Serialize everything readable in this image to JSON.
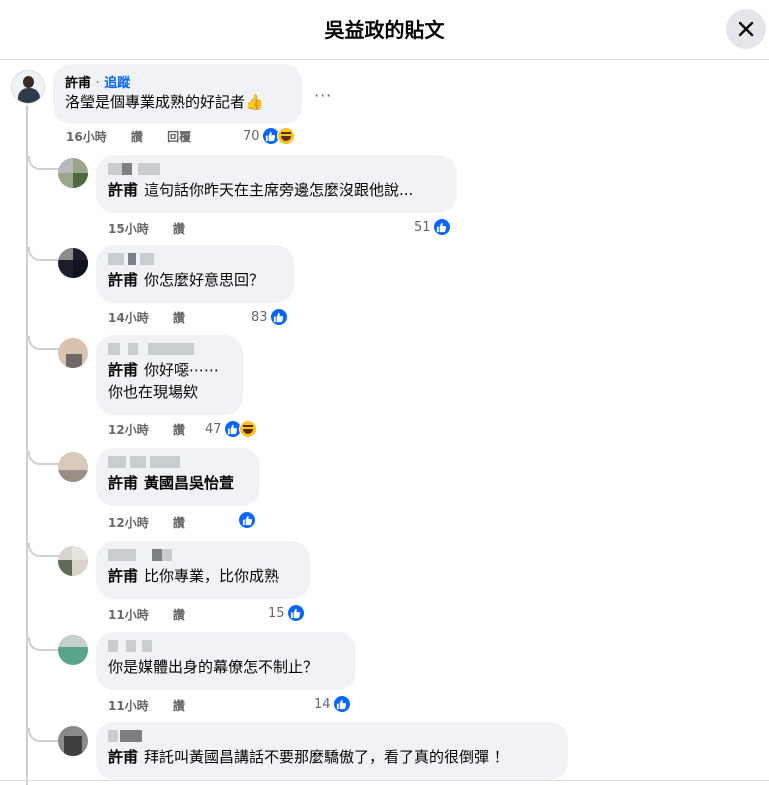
{
  "header": {
    "title": "吳益政的貼文"
  },
  "main_comment": {
    "author": "許甫",
    "separator": "·",
    "follow_label": "追蹤",
    "text": "洛瑩是個專業成熟的好記者👍",
    "time": "16小時",
    "like_label": "讚",
    "reply_label": "回覆",
    "reaction_count": "70",
    "more_label": "···"
  },
  "replies": [
    {
      "mention": "許甫",
      "lines": [
        "這句話你昨天在主席旁邊怎麼沒跟他說..."
      ],
      "time": "15小時",
      "like_label": "讚",
      "reaction_count": "51"
    },
    {
      "mention": "許甫",
      "lines": [
        "你怎麼好意思回？"
      ],
      "time": "14小時",
      "like_label": "讚",
      "reaction_count": "83"
    },
    {
      "mention": "許甫",
      "lines": [
        "你好噁⋯⋯",
        "你也在現場欸"
      ],
      "time": "12小時",
      "like_label": "讚",
      "reaction_count": "47"
    },
    {
      "mention": "許甫",
      "lines": [
        "黃國昌吳怡萱"
      ],
      "time": "12小時",
      "like_label": "讚",
      "reaction_count": ""
    },
    {
      "mention": "許甫",
      "lines": [
        "比你專業，比你成熟"
      ],
      "time": "11小時",
      "like_label": "讚",
      "reaction_count": "15"
    },
    {
      "mention": "",
      "lines": [
        "你是媒體出身的幕僚怎不制止？"
      ],
      "time": "11小時",
      "like_label": "讚",
      "reaction_count": "14"
    },
    {
      "mention": "許甫",
      "lines": [
        "拜託叫黃國昌講話不要那麼驕傲了，看了真的很倒彈 ！"
      ],
      "time": "",
      "like_label": "",
      "reaction_count": ""
    }
  ],
  "colors": {
    "accent": "#0866ff",
    "bubble": "#f0f2f5",
    "muted": "#65676b"
  }
}
